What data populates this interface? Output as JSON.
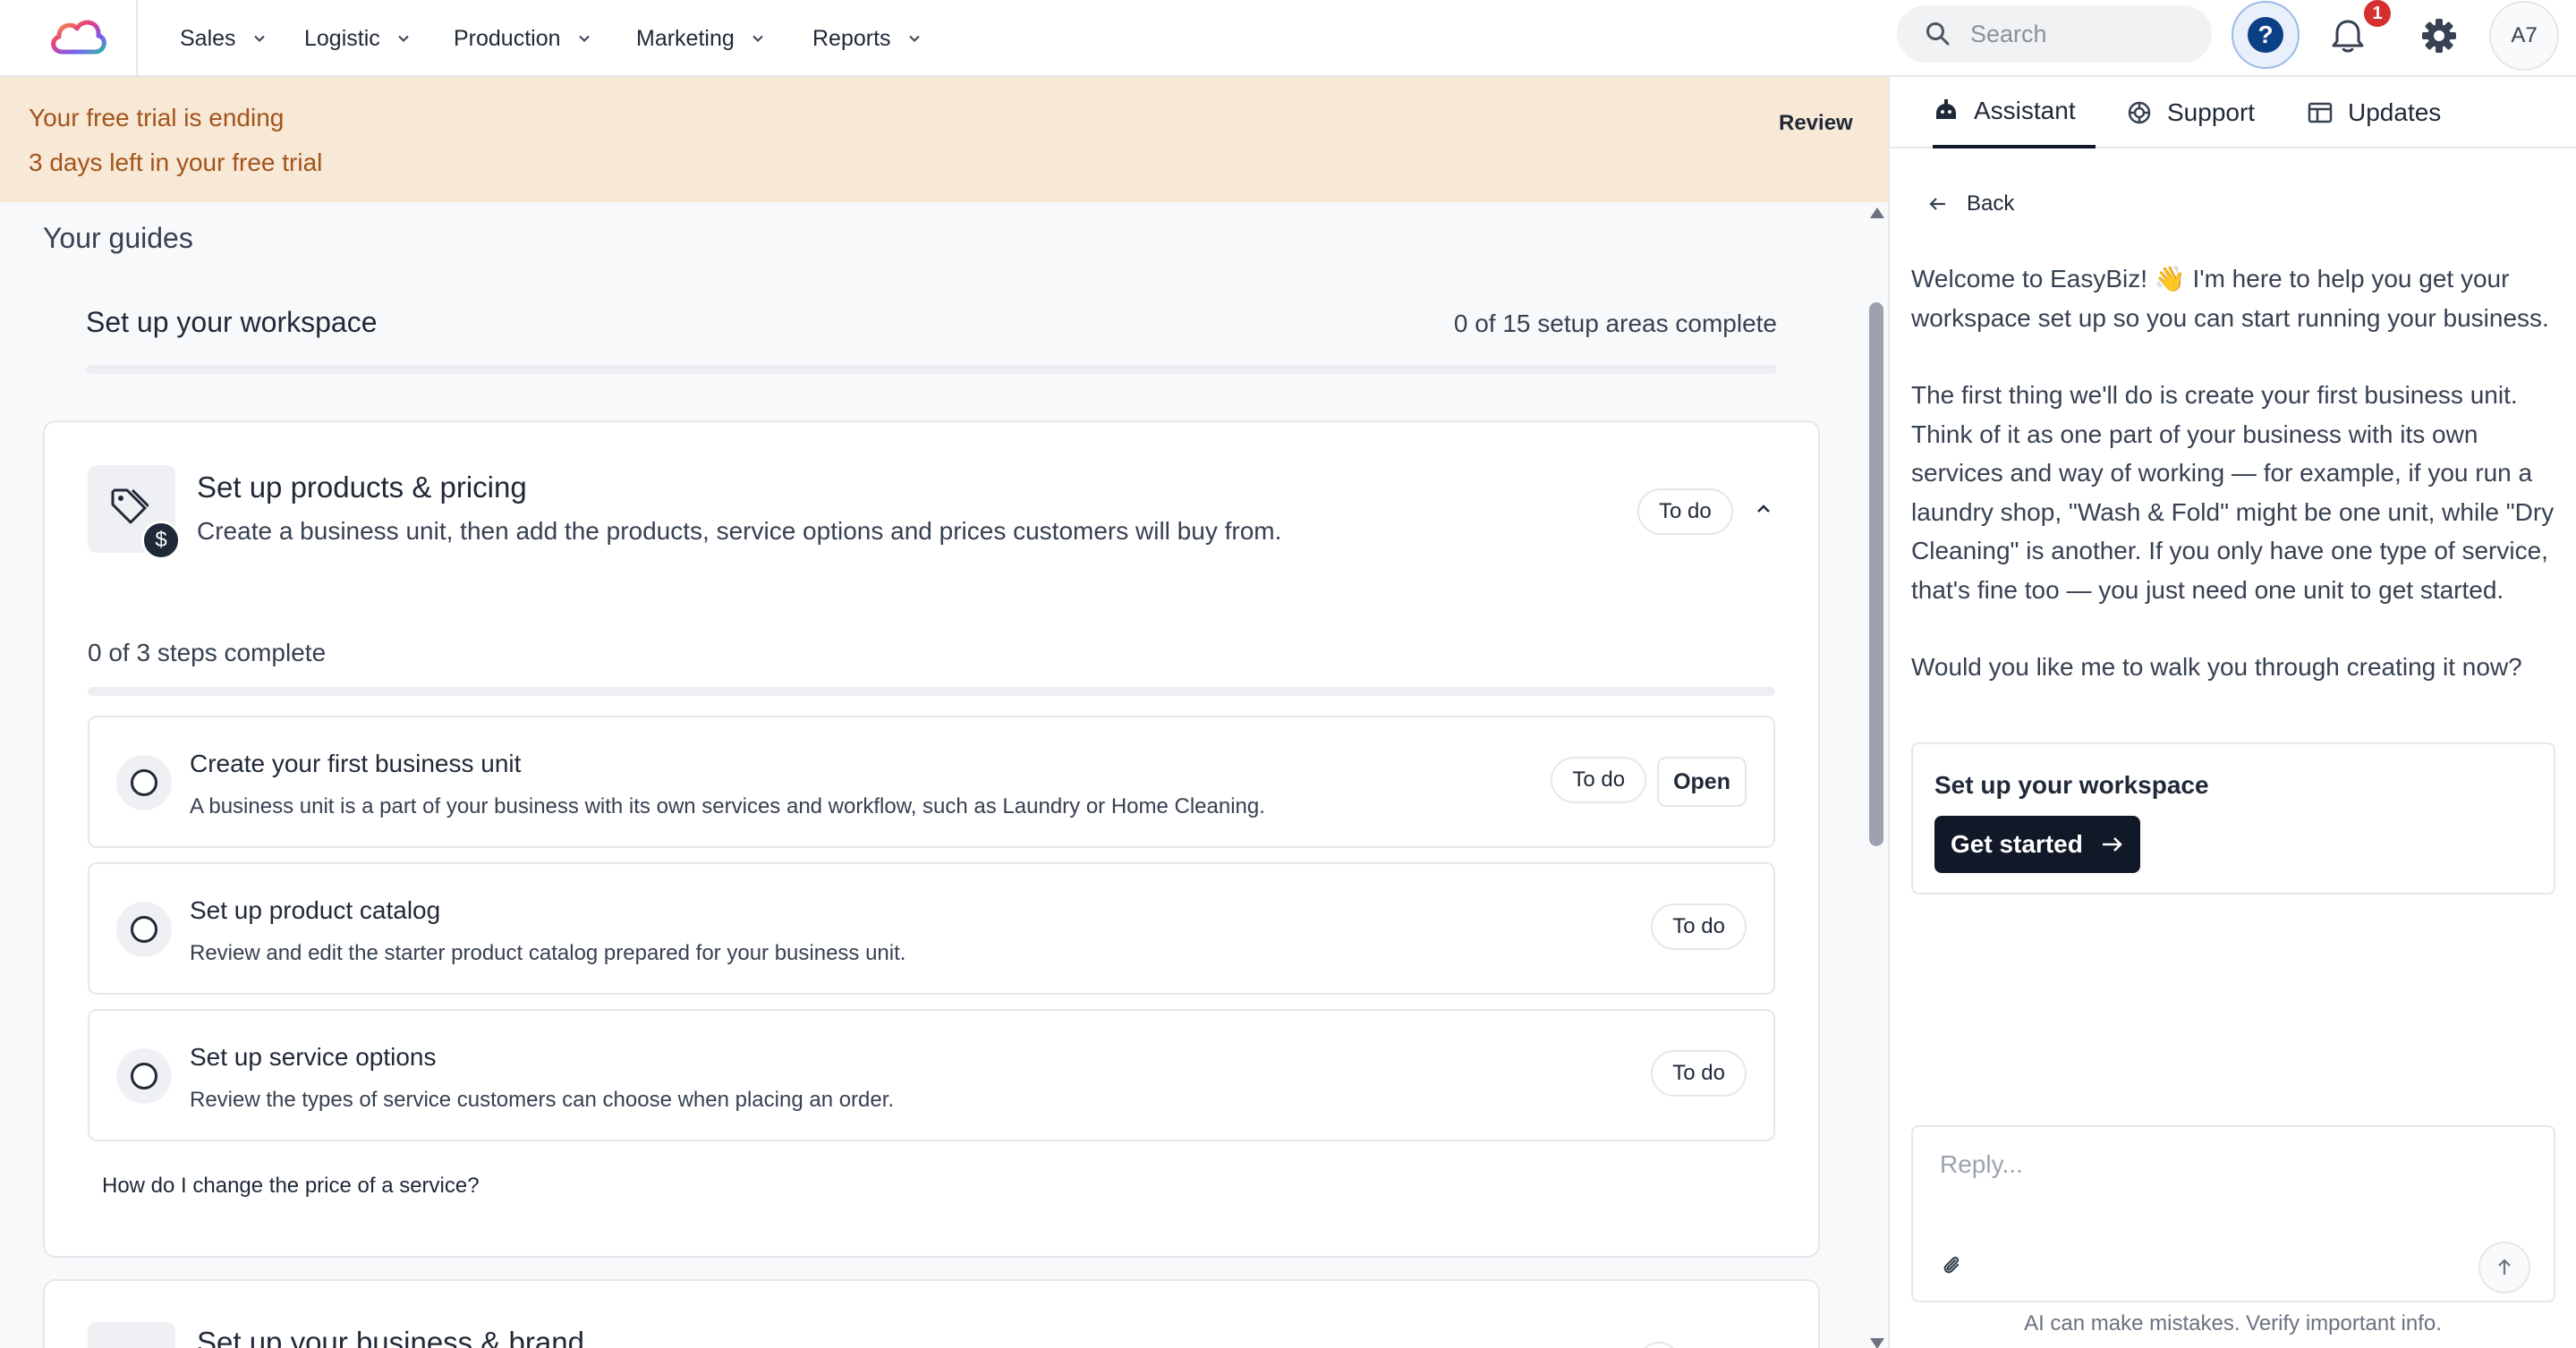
{
  "nav": {
    "items": [
      {
        "label": "Sales"
      },
      {
        "label": "Logistic"
      },
      {
        "label": "Production"
      },
      {
        "label": "Marketing"
      },
      {
        "label": "Reports"
      }
    ],
    "search_placeholder": "Search",
    "help_symbol": "?",
    "notification_count": "1",
    "avatar_initials": "A7"
  },
  "banner": {
    "title": "Your free trial is ending",
    "subtitle": "3 days left in your free trial",
    "action": "Review"
  },
  "guides": {
    "heading": "Your guides",
    "workspace_title": "Set up your workspace",
    "workspace_progress_text": "0 of 15 setup areas complete",
    "workspace_progress": 0,
    "card": {
      "title": "Set up products & pricing",
      "description": "Create a business unit, then add the products, service options and prices customers will buy from.",
      "status": "To do",
      "badge_symbol": "$",
      "steps_progress_text": "0 of 3 steps complete",
      "steps_progress": 0,
      "steps": [
        {
          "title": "Create your first business unit",
          "description": "A business unit is a part of your business with its own services and workflow, such as Laundry or Home Cleaning.",
          "status": "To do",
          "action": "Open"
        },
        {
          "title": "Set up product catalog",
          "description": "Review and edit the starter product catalog prepared for your business unit.",
          "status": "To do"
        },
        {
          "title": "Set up service options",
          "description": "Review the types of service customers can choose when placing an order.",
          "status": "To do"
        }
      ],
      "faq_link": "How do I change the price of a service?"
    },
    "next_card": {
      "title": "Set up your business & brand"
    }
  },
  "panel": {
    "tabs": [
      {
        "label": "Assistant",
        "icon": "assistant-icon",
        "active": true
      },
      {
        "label": "Support",
        "icon": "support-icon",
        "active": false
      },
      {
        "label": "Updates",
        "icon": "updates-icon",
        "active": false
      }
    ],
    "back_label": "Back",
    "message": [
      "Welcome to EasyBiz! 👋 I'm here to help you get your workspace set up so you can start running your business.",
      "The first thing we'll do is create your first business unit. Think of it as one part of your business with its own services and way of working — for example, if you run a laundry shop, \"Wash & Fold\" might be one unit, while \"Dry Cleaning\" is another. If you only have one type of service, that's fine too — you just need one unit to get started.",
      "Would you like me to walk you through creating it now?"
    ],
    "action_card": {
      "title": "Set up your workspace",
      "button": "Get started"
    },
    "reply_placeholder": "Reply...",
    "disclaimer": "AI can make mistakes. Verify important info."
  },
  "colors": {
    "banner_bg": "#f8e8d6",
    "banner_text": "#a2541b",
    "primary_dark": "#111827",
    "help_accent": "#0b3f86",
    "badge_red": "#d62f2f"
  }
}
